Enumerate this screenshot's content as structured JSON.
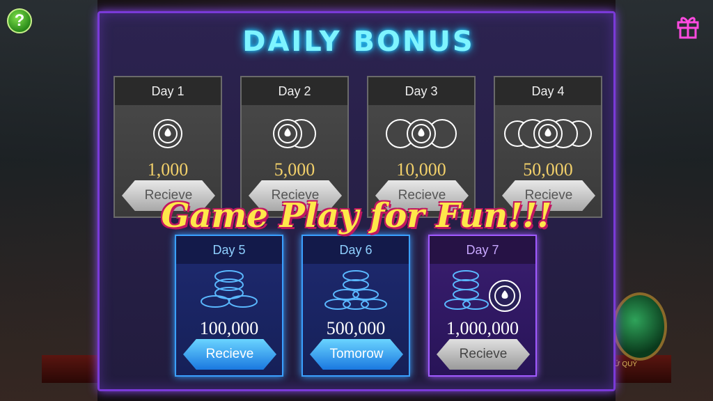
{
  "header": {
    "title": "DAILY BONUS",
    "help_label": "?"
  },
  "days": [
    {
      "label": "Day 1",
      "amount": "1,000",
      "button": "Recieve",
      "icon": "single-chip-icon"
    },
    {
      "label": "Day 2",
      "amount": "5,000",
      "button": "Recieve",
      "icon": "double-chip-icon"
    },
    {
      "label": "Day 3",
      "amount": "10,000",
      "button": "Recieve",
      "icon": "triple-chip-icon"
    },
    {
      "label": "Day 4",
      "amount": "50,000",
      "button": "Recieve",
      "icon": "quad-chip-icon"
    },
    {
      "label": "Day 5",
      "amount": "100,000",
      "button": "Recieve",
      "icon": "chip-stack-icon"
    },
    {
      "label": "Day 6",
      "amount": "500,000",
      "button": "Tomorow",
      "icon": "chip-pile-icon"
    },
    {
      "label": "Day 7",
      "amount": "1,000,000",
      "button": "Recieve",
      "icon": "chip-pile-large-icon"
    }
  ],
  "overlay_text": "Game Play for Fun!!!",
  "background": {
    "caption": "TỨ QUÝ"
  },
  "colors": {
    "title_glow": "#7ef4ff",
    "panel_border": "#7a3ad8",
    "amount_gold": "#f2d06a",
    "active_blue": "#3aa0ff"
  }
}
